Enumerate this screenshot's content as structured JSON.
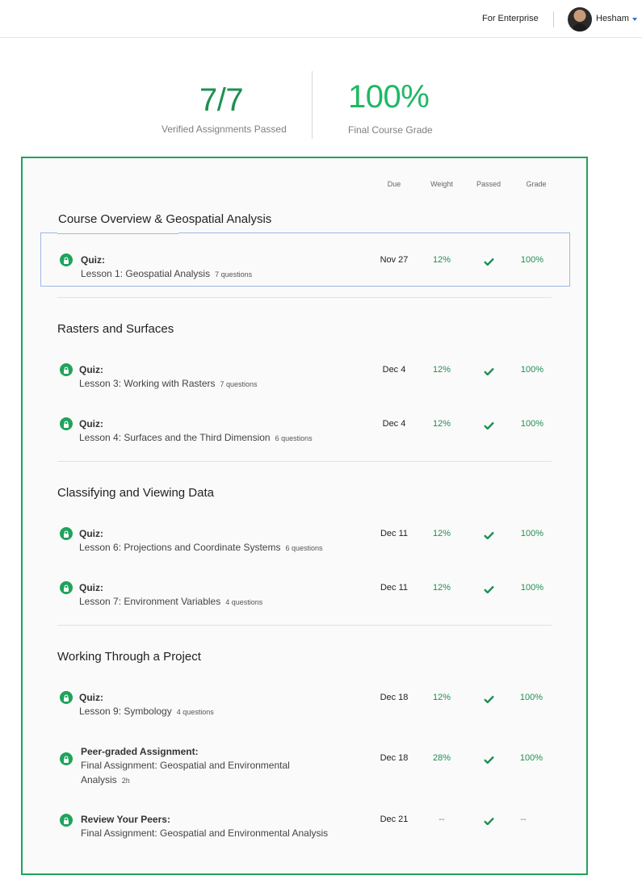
{
  "header": {
    "enterprise_label": "For Enterprise",
    "user_name": "Hesham"
  },
  "summary": {
    "assignments_value": "7/7",
    "assignments_label": "Verified Assignments Passed",
    "grade_value": "100%",
    "grade_label": "Final Course Grade"
  },
  "columns": {
    "due": "Due",
    "weight": "Weight",
    "passed": "Passed",
    "grade": "Grade"
  },
  "colors": {
    "accent": "#1fa35b",
    "grade_text": "#1f8f51",
    "focus_outline": "#9db8e4"
  },
  "sections": [
    {
      "title": "Course Overview & Geospatial Analysis",
      "items": [
        {
          "type": "Quiz:",
          "name": "Lesson 1: Geospatial Analysis",
          "meta": "7 questions",
          "due": "Nov 27",
          "weight": "12%",
          "passed": true,
          "grade": "100%"
        }
      ]
    },
    {
      "title": "Rasters and Surfaces",
      "items": [
        {
          "type": "Quiz:",
          "name": "Lesson 3: Working with Rasters",
          "meta": "7 questions",
          "due": "Dec 4",
          "weight": "12%",
          "passed": true,
          "grade": "100%"
        },
        {
          "type": "Quiz:",
          "name": "Lesson 4: Surfaces and the Third Dimension",
          "meta": "6 questions",
          "due": "Dec 4",
          "weight": "12%",
          "passed": true,
          "grade": "100%"
        }
      ]
    },
    {
      "title": "Classifying and Viewing Data",
      "items": [
        {
          "type": "Quiz:",
          "name": "Lesson 6: Projections and Coordinate Systems",
          "meta": "6 questions",
          "due": "Dec 11",
          "weight": "12%",
          "passed": true,
          "grade": "100%"
        },
        {
          "type": "Quiz:",
          "name": "Lesson 7: Environment Variables",
          "meta": "4 questions",
          "due": "Dec 11",
          "weight": "12%",
          "passed": true,
          "grade": "100%"
        }
      ]
    },
    {
      "title": "Working Through a Project",
      "items": [
        {
          "type": "Quiz:",
          "name": "Lesson 9: Symbology",
          "meta": "4 questions",
          "due": "Dec 18",
          "weight": "12%",
          "passed": true,
          "grade": "100%"
        },
        {
          "type": "Peer-graded Assignment:",
          "name": "Final Assignment: Geospatial and Environmental Analysis",
          "meta": "2h",
          "due": "Dec 18",
          "weight": "28%",
          "passed": true,
          "grade": "100%"
        },
        {
          "type": "Review Your Peers:",
          "name": "Final Assignment: Geospatial and Environmental Analysis",
          "meta": "",
          "due": "Dec 21",
          "weight": "--",
          "passed": true,
          "grade": "--"
        }
      ]
    }
  ]
}
